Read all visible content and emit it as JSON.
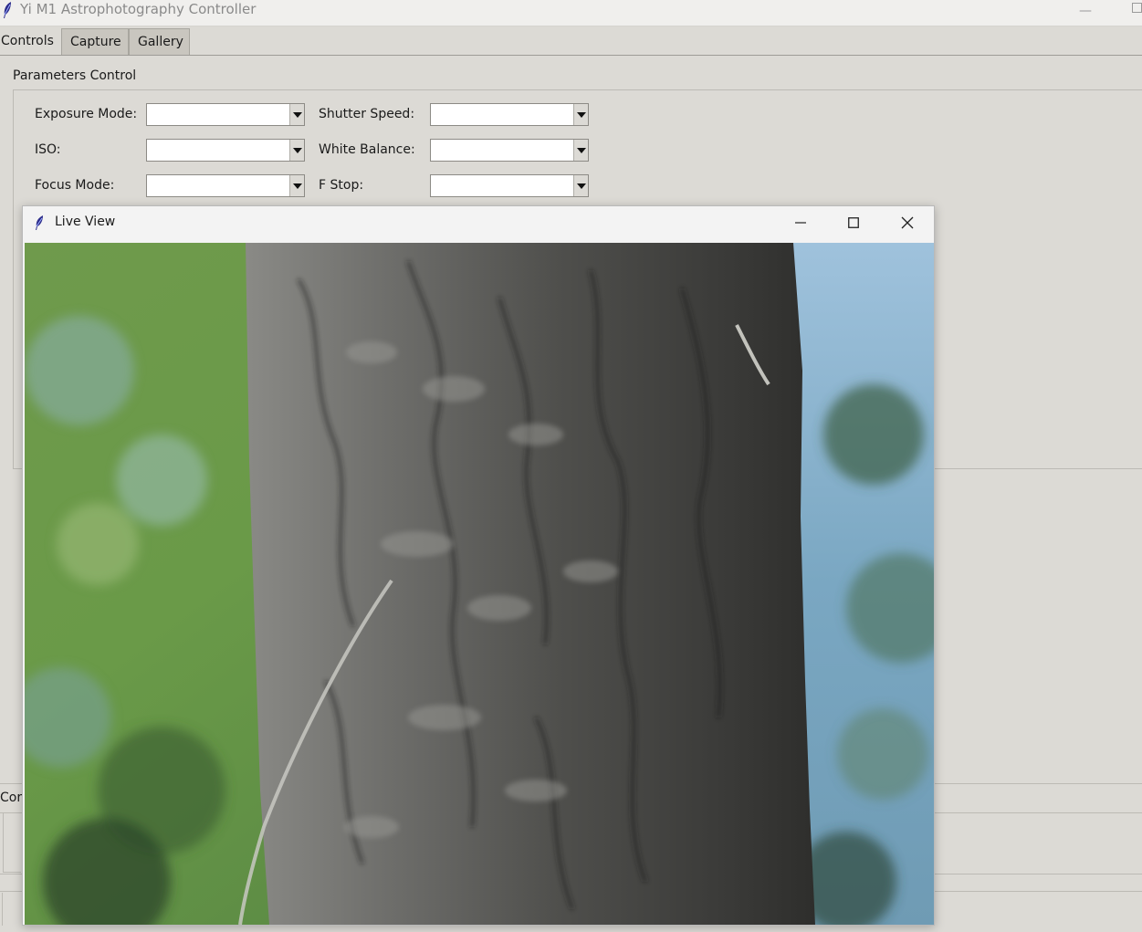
{
  "app": {
    "title": "Yi M1 Astrophotography Controller"
  },
  "tabs": [
    {
      "label": "Controls",
      "active": true
    },
    {
      "label": "Capture",
      "active": false
    },
    {
      "label": "Gallery",
      "active": false
    }
  ],
  "parameters": {
    "frame_label": "Parameters Control",
    "exposure_mode": {
      "label": "Exposure Mode:",
      "value": ""
    },
    "shutter_speed": {
      "label": "Shutter Speed:",
      "value": ""
    },
    "iso": {
      "label": "ISO:",
      "value": ""
    },
    "white_balance": {
      "label": "White Balance:",
      "value": ""
    },
    "focus_mode": {
      "label": "Focus Mode:",
      "value": ""
    },
    "f_stop": {
      "label": "F Stop:",
      "value": ""
    }
  },
  "lower_frame": {
    "label_fragment": "Cor"
  },
  "live_view": {
    "title": "Live View",
    "image_subject": "tree-bark-photo"
  },
  "colors": {
    "window_bg": "#dcdad5",
    "tab_inactive": "#c9c6bf",
    "titlebar": "#f0efed"
  }
}
